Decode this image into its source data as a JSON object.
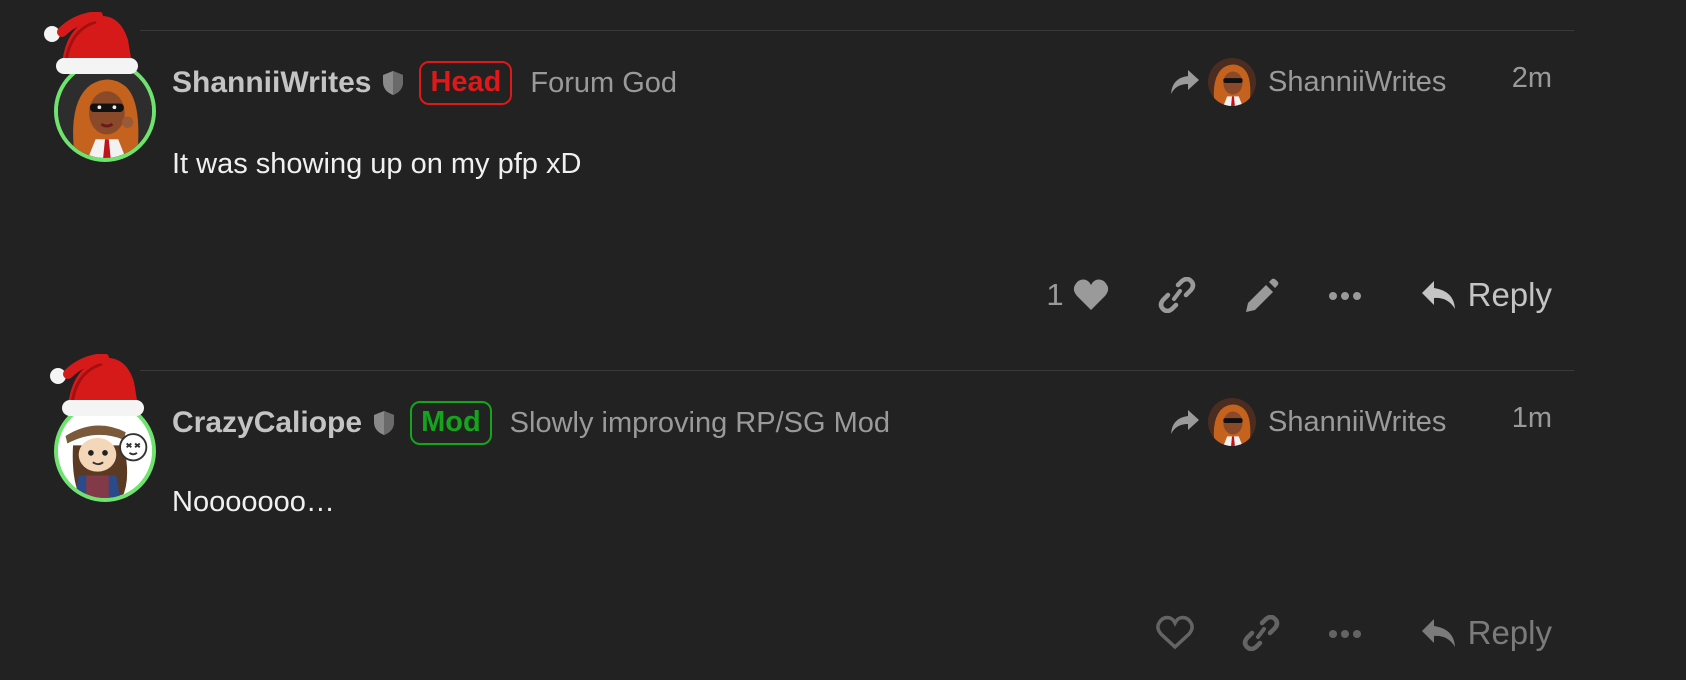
{
  "posts": [
    {
      "username": "ShanniiWrites",
      "flair": "Head",
      "user_title": "Forum God",
      "reply_to_name": "ShanniiWrites",
      "time": "2m",
      "body": "It was showing up on my pfp xD",
      "like_count": "1",
      "reply_label": "Reply"
    },
    {
      "username": "CrazyCaliope",
      "flair": "Mod",
      "user_title": "Slowly improving RP/SG Mod",
      "reply_to_name": "ShanniiWrites",
      "time": "1m",
      "body": "Nooooooo…",
      "reply_label": "Reply"
    }
  ],
  "colors": {
    "background": "#222222",
    "avatar_ring": "#6ee46e",
    "flair_head": "#e01818",
    "flair_mod": "#15a41c",
    "muted_text": "#9a9a9a"
  }
}
